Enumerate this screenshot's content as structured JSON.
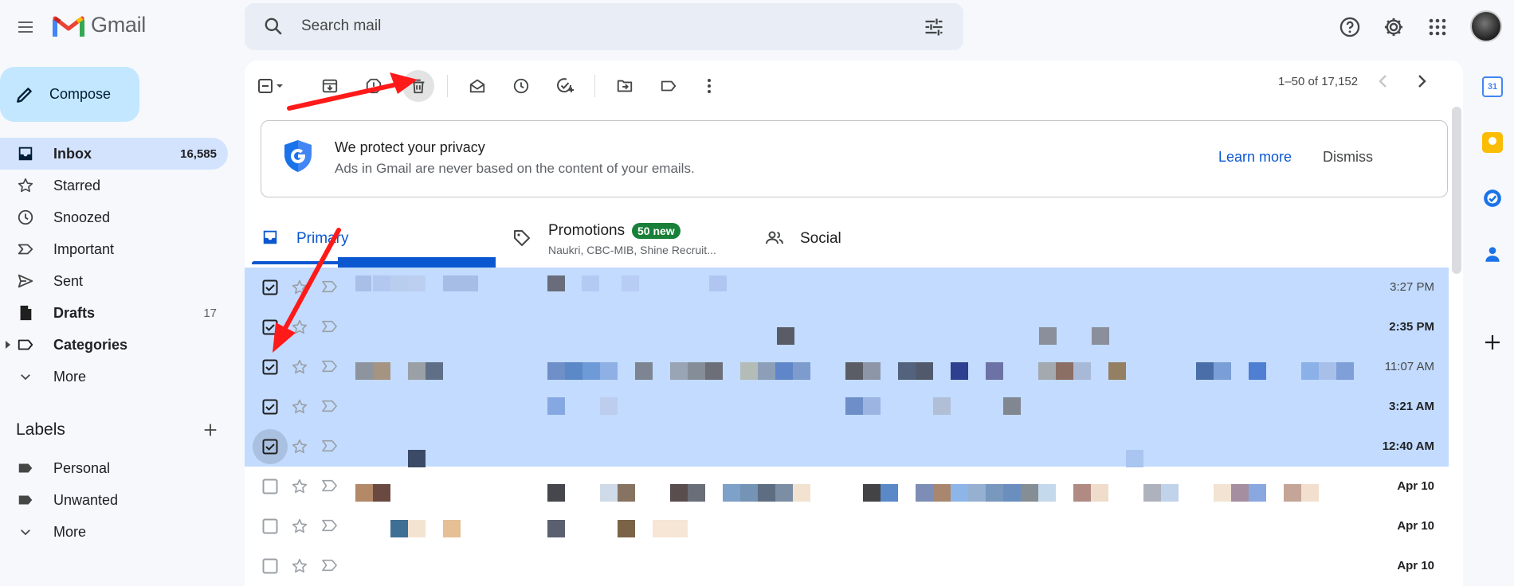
{
  "app": {
    "name": "Gmail"
  },
  "search": {
    "placeholder": "Search mail"
  },
  "compose": {
    "label": "Compose"
  },
  "nav": [
    {
      "label": "Inbox",
      "count": "16,585",
      "icon": "inbox-icon",
      "active": true
    },
    {
      "label": "Starred",
      "count": "",
      "icon": "star-icon"
    },
    {
      "label": "Snoozed",
      "count": "",
      "icon": "clock-icon"
    },
    {
      "label": "Important",
      "count": "",
      "icon": "important-icon"
    },
    {
      "label": "Sent",
      "count": "",
      "icon": "send-icon"
    },
    {
      "label": "Drafts",
      "count": "17",
      "icon": "draft-icon",
      "bold": true
    },
    {
      "label": "Categories",
      "count": "",
      "icon": "label-icon",
      "bold": true
    },
    {
      "label": "More",
      "count": "",
      "icon": "chevron-down-icon"
    }
  ],
  "labels": {
    "header": "Labels",
    "items": [
      {
        "label": "Personal",
        "icon": "label-filled-icon"
      },
      {
        "label": "Unwanted",
        "icon": "label-filled-icon"
      },
      {
        "label": "More",
        "icon": "chevron-down-icon"
      }
    ]
  },
  "toolbar": {
    "pagination": "1–50 of 17,152",
    "icons": [
      "select-all-checkbox-icon",
      "archive-icon",
      "report-spam-icon",
      "delete-icon",
      "mark-read-icon",
      "snooze-icon",
      "add-to-tasks-icon",
      "move-to-icon",
      "label-icon",
      "more-vert-icon"
    ]
  },
  "banner": {
    "title": "We protect your privacy",
    "subtitle": "Ads in Gmail are never based on the content of your emails.",
    "learn_more": "Learn more",
    "dismiss": "Dismiss"
  },
  "tabs": {
    "primary": "Primary",
    "promotions": "Promotions",
    "promotions_badge": "50 new",
    "promotions_sub": "Naukri, CBC-MIB, Shine Recruit...",
    "social": "Social"
  },
  "emails": [
    {
      "time": "3:27 PM",
      "selected": true,
      "unread": false
    },
    {
      "time": "2:35 PM",
      "selected": true,
      "unread": true
    },
    {
      "time": "11:07 AM",
      "selected": true,
      "unread": false
    },
    {
      "time": "3:21 AM",
      "selected": true,
      "unread": true
    },
    {
      "time": "12:40 AM",
      "selected": true,
      "unread": true
    },
    {
      "time": "Apr 10",
      "selected": false,
      "unread": true
    },
    {
      "time": "Apr 10",
      "selected": false,
      "unread": true
    },
    {
      "time": "Apr 10",
      "selected": false,
      "unread": true
    }
  ],
  "colors": {
    "accent": "#0b57d0",
    "selected_row": "#c2dbff",
    "compose": "#c2e7ff",
    "annotation_arrow": "#ff1a1a"
  }
}
